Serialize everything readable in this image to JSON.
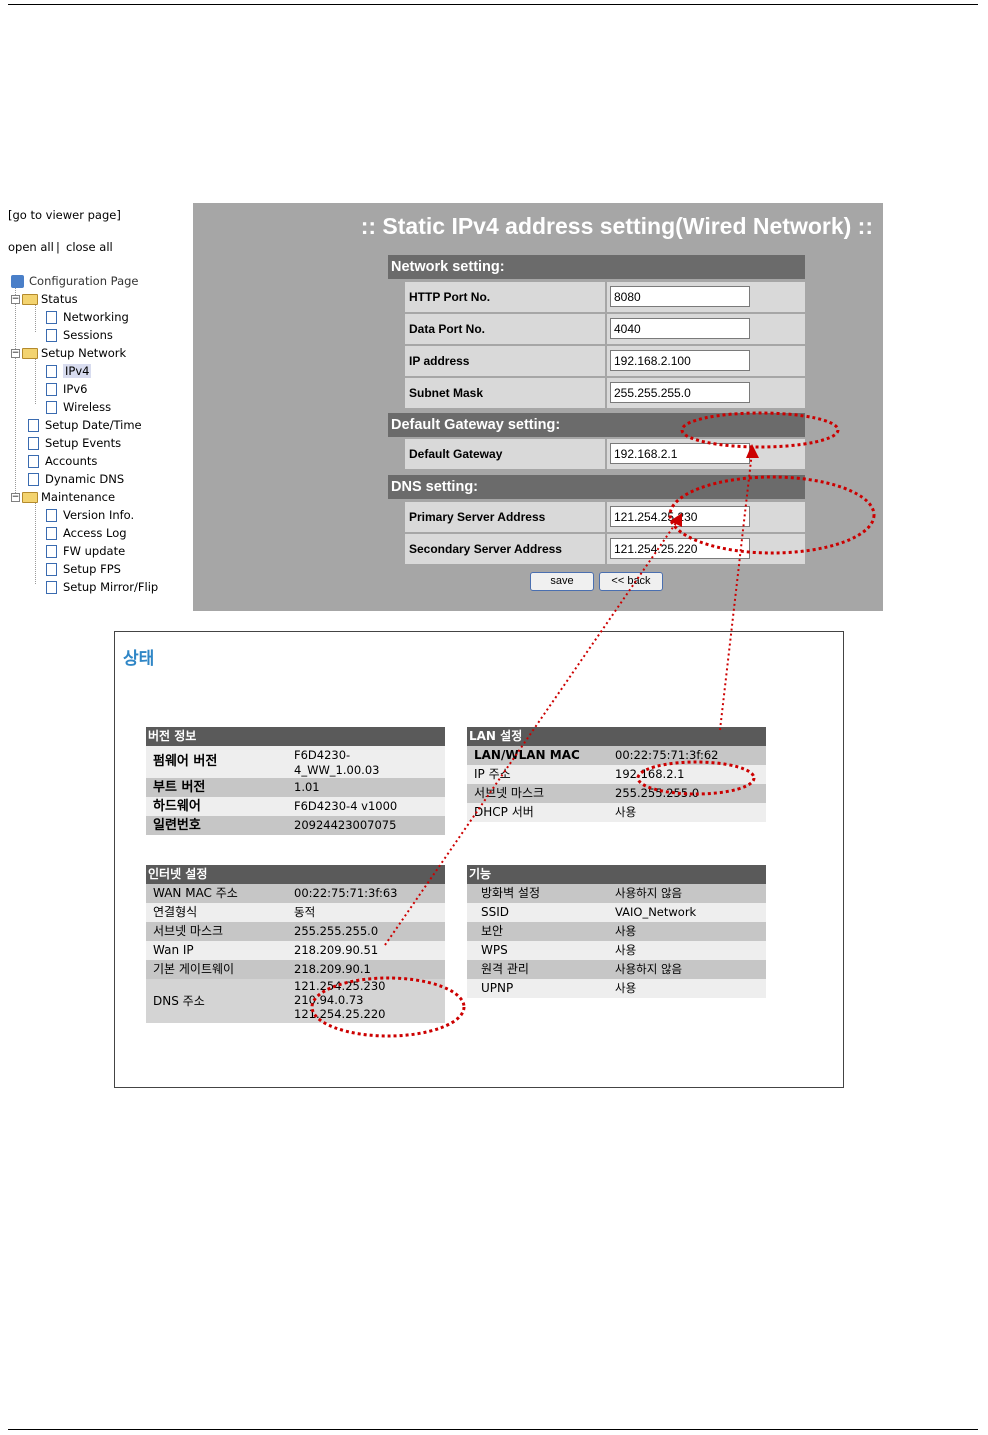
{
  "left_nav": {
    "viewer_link": "[go to viewer page]",
    "open_all": "open all",
    "separator": "|",
    "close_all": "close all",
    "tree": [
      {
        "label": "Configuration Page",
        "level": 0,
        "type": "root"
      },
      {
        "label": "Status",
        "level": 1,
        "type": "folder"
      },
      {
        "label": "Networking",
        "level": 2,
        "type": "page"
      },
      {
        "label": "Sessions",
        "level": 2,
        "type": "page"
      },
      {
        "label": "Setup Network",
        "level": 1,
        "type": "folder"
      },
      {
        "label": "IPv4",
        "level": 2,
        "type": "page",
        "selected": true
      },
      {
        "label": "IPv6",
        "level": 2,
        "type": "page"
      },
      {
        "label": "Wireless",
        "level": 2,
        "type": "page"
      },
      {
        "label": "Setup Date/Time",
        "level": 1,
        "type": "page"
      },
      {
        "label": "Setup Events",
        "level": 1,
        "type": "page"
      },
      {
        "label": "Accounts",
        "level": 1,
        "type": "page"
      },
      {
        "label": "Dynamic DNS",
        "level": 1,
        "type": "page"
      },
      {
        "label": "Maintenance",
        "level": 1,
        "type": "folder"
      },
      {
        "label": "Version Info.",
        "level": 2,
        "type": "page"
      },
      {
        "label": "Access Log",
        "level": 2,
        "type": "page"
      },
      {
        "label": "FW update",
        "level": 2,
        "type": "page"
      },
      {
        "label": "Setup FPS",
        "level": 2,
        "type": "page"
      },
      {
        "label": "Setup Mirror/Flip",
        "level": 2,
        "type": "page"
      }
    ]
  },
  "form": {
    "title": ":: Static IPv4 address setting(Wired Network) ::",
    "network_section": "Network setting:",
    "http_port_label": "HTTP Port No.",
    "http_port_value": "8080",
    "data_port_label": "Data Port No.",
    "data_port_value": "4040",
    "ip_label": "IP address",
    "ip_value": "192.168.2.100",
    "subnet_label": "Subnet Mask",
    "subnet_value": "255.255.255.0",
    "gateway_section": "Default Gateway setting:",
    "gateway_label": "Default Gateway",
    "gateway_value": "192.168.2.1",
    "dns_section": "DNS setting:",
    "primary_dns_label": "Primary Server Address",
    "primary_dns_value": "121.254.25.230",
    "secondary_dns_label": "Secondary Server Address",
    "secondary_dns_value": "121.254.25.220",
    "save_button": "save",
    "back_button": "<< back"
  },
  "status": {
    "title": "상태",
    "version": {
      "header": "버전 정보",
      "firmware_label": "펌웨어 버전",
      "firmware_value_line1": "F6D4230-",
      "firmware_value_line2": "4_WW_1.00.03",
      "boot_label": "부트 버전",
      "boot_value": "1.01",
      "hardware_label": "하드웨어",
      "hardware_value": "F6D4230-4 v1000",
      "serial_label": "일련번호",
      "serial_value": "20924423007075"
    },
    "lan": {
      "header": "LAN 설정",
      "mac_label": "LAN/WLAN MAC",
      "mac_value": "00:22:75:71:3f:62",
      "ip_label": "IP 주소",
      "ip_value": "192.168.2.1",
      "subnet_label": "서브넷 마스크",
      "subnet_value": "255.255.255.0",
      "dhcp_label": "DHCP 서버",
      "dhcp_value": "사용"
    },
    "internet": {
      "header": "인터넷 설정",
      "wan_mac_label": "WAN MAC 주소",
      "wan_mac_value": "00:22:75:71:3f:63",
      "conn_type_label": "연결형식",
      "conn_type_value": "동적",
      "subnet_label": "서브넷 마스크",
      "subnet_value": "255.255.255.0",
      "wan_ip_label": "Wan IP",
      "wan_ip_value": "218.209.90.51",
      "gateway_label": "기본 게이트웨이",
      "gateway_value": "218.209.90.1",
      "dns_label": "DNS 주소",
      "dns_value1": "121.254.25.230",
      "dns_value2": "210.94.0.73",
      "dns_value3": "121.254.25.220"
    },
    "features": {
      "header": "기능",
      "firewall_label": "방화벽 설정",
      "firewall_value": "사용하지 않음",
      "ssid_label": "SSID",
      "ssid_value": "VAIO_Network",
      "security_label": "보안",
      "security_value": "사용",
      "wps_label": "WPS",
      "wps_value": "사용",
      "remote_label": "원격 관리",
      "remote_value": "사용하지 않음",
      "upnp_label": "UPNP",
      "upnp_value": "사용"
    }
  },
  "annotation_color": "#cc0000"
}
